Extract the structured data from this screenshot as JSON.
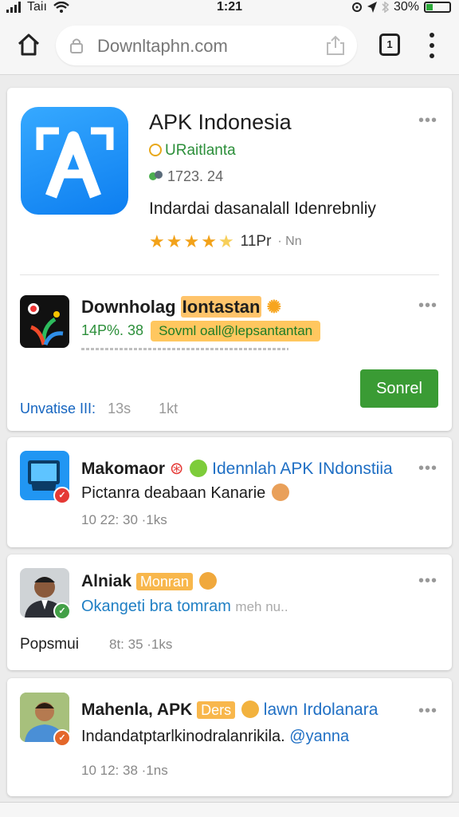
{
  "status_bar": {
    "carrier": "Taiı",
    "time": "1:21",
    "battery_text": "30%",
    "battery_level": 0.3,
    "battery_color": "#2aa838"
  },
  "toolbar": {
    "url": "Downltaphn.com",
    "tab_count": "1"
  },
  "app_card": {
    "title": "APK Indonesia",
    "developer": "URaitlanta",
    "downloads": "1723. 24",
    "description": "Indardai dasanalall Idenrebnliy",
    "rating": 4.5,
    "rating_text": "11Pr",
    "rating_count": "· Nn",
    "related": {
      "title": "Downholag",
      "title_highlight": "Iontastan",
      "meta_text": "14P%. 38",
      "tag_text": "Sovml oall@lepsantantan",
      "footer_label": "Unvatise III:",
      "footer_time": "13s",
      "footer_count": "1kt",
      "button_label": "Sonrel"
    }
  },
  "posts": [
    {
      "name": "Makomaor",
      "link_text": "Idennlah APK INdonstiia",
      "body": "Pictanra deabaan Kanarie",
      "time": "10 22: 30 ·1ks"
    },
    {
      "name": "Alniak",
      "tag": "Monran",
      "body": "Okangeti bra tomram",
      "body_faint": "meh nu..",
      "footer_label": "Popsmui",
      "time": "8t: 35 ·1ks"
    },
    {
      "name": "Mahenla, APK",
      "tag": "Ders",
      "link_text": "lawn Irdolanara",
      "body": "Indandatptarlkinodralanrikila.",
      "mention": "@yanna",
      "time": "10 12: 38 ·1ns"
    }
  ],
  "colors": {
    "accent_blue": "#1f6fc4",
    "accent_green": "#3a9b34",
    "star": "#f2a21a",
    "highlight": "#ffc46b"
  }
}
